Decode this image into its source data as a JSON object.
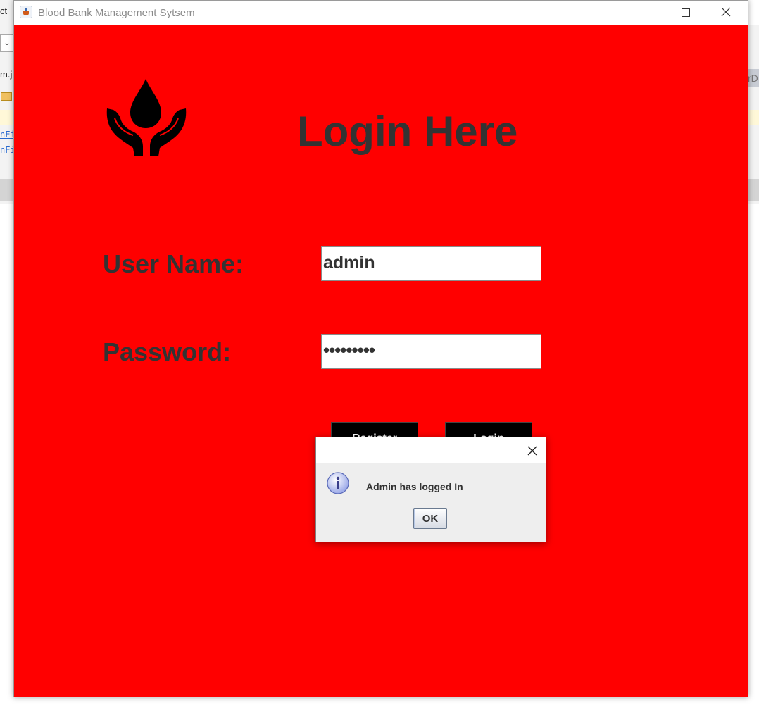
{
  "background_ide": {
    "frag_top_left": "ct",
    "dropdown_chevron": "chevron-down-icon",
    "frag_mid_left": "m.j",
    "link1": "nFi",
    "link2": "nFi",
    "frag_right": "rD"
  },
  "window": {
    "title": "Blood Bank Management Sytsem",
    "controls": {
      "minimize": "minimize-icon",
      "maximize": "maximize-icon",
      "close": "close-icon"
    }
  },
  "login": {
    "heading": "Login Here",
    "logo_icon": "blood-drop-hands-icon",
    "username_label": "User Name:",
    "username_value": "admin",
    "password_label": "Password:",
    "password_value": "•••••••••",
    "button1_label": "Register",
    "button2_label": "Login",
    "background_color": "#ff0000",
    "text_color": "#333333"
  },
  "dialog": {
    "message": "Admin has logged In",
    "ok_label": "OK",
    "icon": "information-icon"
  }
}
